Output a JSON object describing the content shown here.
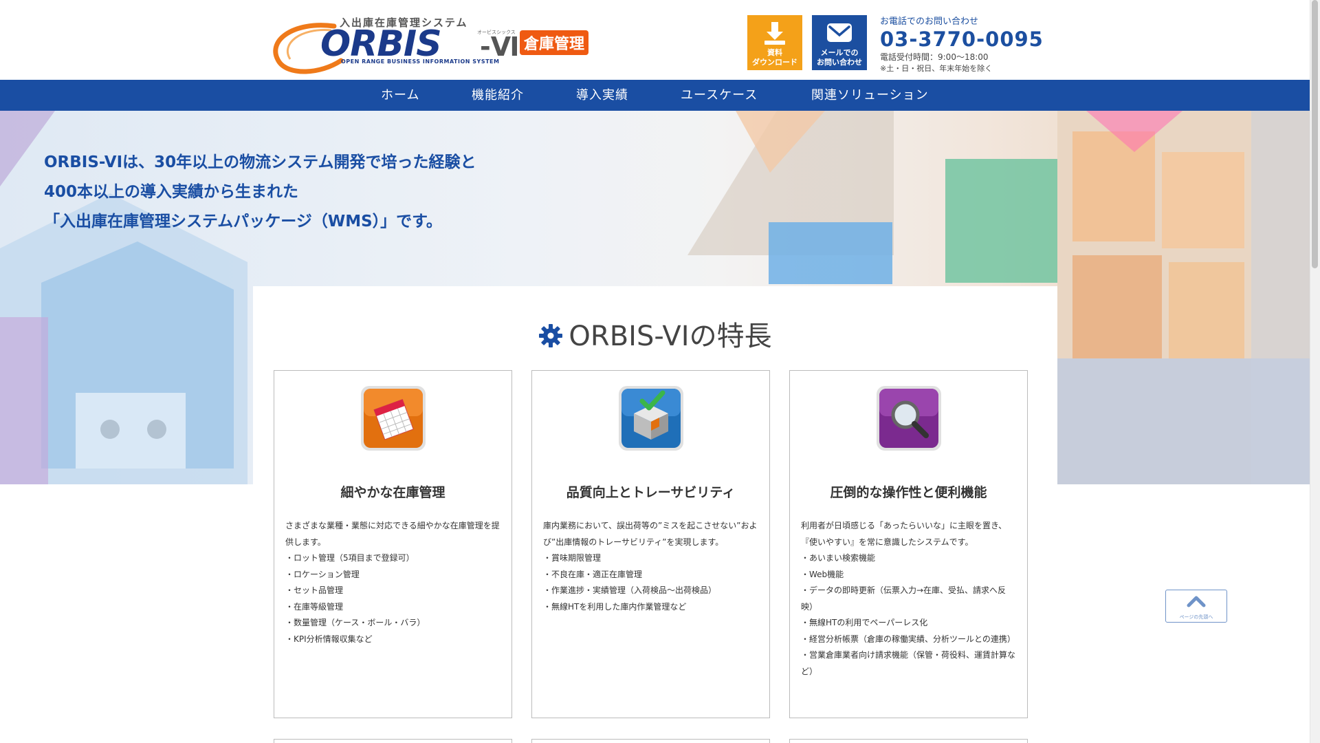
{
  "header": {
    "logo": {
      "catch": "入出庫在庫管理システム",
      "name": "ORBIS",
      "suffix": "-Ⅵ",
      "kana": "オービスシックス",
      "tagline": "OPEN RANGE BUSINESS INFORMATION SYSTEM",
      "badge": "倉庫管理"
    },
    "download_button": {
      "line1": "資料",
      "line2": "ダウンロード",
      "icon": "download-icon"
    },
    "mail_button": {
      "line1": "メールでの",
      "line2": "お問い合わせ",
      "icon": "mail-icon"
    },
    "contact": {
      "label": "お電話でのお問い合わせ",
      "phone": "03-3770-0095",
      "hours": "電話受付時間：9:00〜18:00",
      "note": "※土・日・祝日、年末年始を除く"
    }
  },
  "nav": {
    "items": [
      {
        "label": "ホーム"
      },
      {
        "label": "機能紹介"
      },
      {
        "label": "導入実績"
      },
      {
        "label": "ユースケース"
      },
      {
        "label": "関連ソリューション"
      }
    ]
  },
  "hero": {
    "line1": "ORBIS-VIは、30年以上の物流システム開発で培った経験と",
    "line2": "400本以上の導入実績から生まれた",
    "line3": "「入出庫在庫管理システムパッケージ（WMS）」です。"
  },
  "features": {
    "title": "ORBIS-VIの特長",
    "cards": [
      {
        "icon": "calendar-icon",
        "color": "#e2700f",
        "title": "細やかな在庫管理",
        "lines": [
          "さまざまな業種・業態に対応できる細やかな在庫管理を提供します。",
          "・ロット管理（5項目まで登録可）",
          "・ロケーション管理",
          "・セット品管理",
          "・在庫等級管理",
          "・数量管理（ケース・ボール・バラ）",
          "・KPI分析情報収集など"
        ]
      },
      {
        "icon": "cube-check-icon",
        "color": "#1f6fb8",
        "title": "品質向上とトレーサビリティ",
        "lines": [
          "庫内業務において、誤出荷等の”ミスを起こさせない”および”出庫情報のトレーサビリティ”を実現します。",
          "・賞味期限管理",
          "・不良在庫・適正在庫管理",
          "・作業進捗・実績管理（入荷検品〜出荷検品）",
          "・無線HTを利用した庫内作業管理など"
        ]
      },
      {
        "icon": "magnifier-icon",
        "color": "#7b2a8f",
        "title": "圧倒的な操作性と便利機能",
        "lines": [
          "利用者が日頃感じる「あったらいいな」に主眼を置き、『使いやすい』を常に意識したシステムです。",
          "・あいまい検索機能",
          "・Web機能",
          "・データの即時更新（伝票入力→在庫、受払、請求へ反映）",
          "・無線HTの利用でペーパーレス化",
          "・経営分析帳票（倉庫の稼働実績、分析ツールとの連携）",
          "・営業倉庫業者向け請求機能（保管・荷役料、運賃計算など）"
        ]
      }
    ]
  },
  "page_top": {
    "label": "ページの先頭へ"
  }
}
